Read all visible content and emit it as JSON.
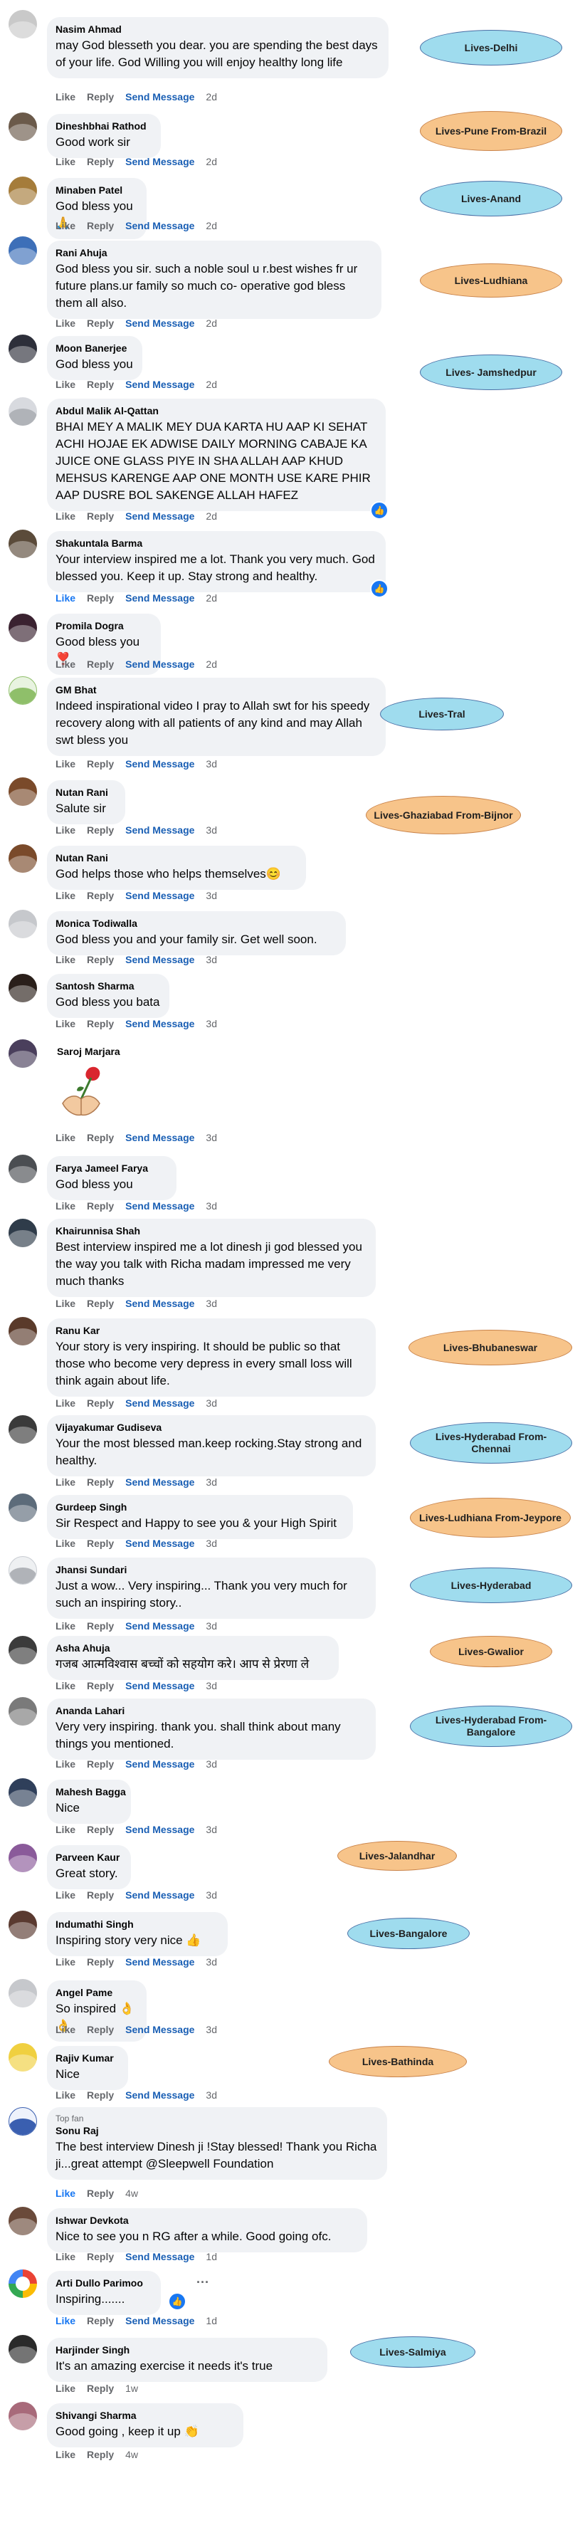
{
  "actions": {
    "like": "Like",
    "reply": "Reply",
    "send": "Send Message"
  },
  "colors": {
    "blue_tag": "#9fdcee",
    "orange_tag": "#f7c48a",
    "bubble": "#f0f2f5",
    "link": "#1a5fb4"
  },
  "comments": [
    {
      "name": "Nasim Ahmad",
      "text": "may God blesseth you dear. you are spending the best days of your life. God Willing you will enjoy healthy long life",
      "time": "2d",
      "location": "Lives-Delhi",
      "tag": "blue"
    },
    {
      "name": "Dineshbhai Rathod",
      "text": "Good work sir",
      "time": "2d",
      "location": "Lives-Pune From-Brazil",
      "tag": "orange"
    },
    {
      "name": "Minaben Patel",
      "text": "God bless you 🙏",
      "time": "2d",
      "location": "Lives-Anand",
      "tag": "blue"
    },
    {
      "name": "Rani Ahuja",
      "text": "God bless you sir. such a noble soul u r.best wishes fr ur future plans.ur family so much co- operative god bless them all also.",
      "time": "2d",
      "location": "Lives-Ludhiana",
      "tag": "orange"
    },
    {
      "name": "Moon Banerjee",
      "text": "God bless you",
      "time": "2d",
      "location": "Lives- Jamshedpur",
      "tag": "blue"
    },
    {
      "name": "Abdul Malik Al-Qattan",
      "text": "BHAI MEY A MALIK MEY DUA KARTA HU AAP KI SEHAT ACHI HOJAE EK ADWISE DAILY MORNING CABAJE KA JUICE ONE GLASS PIYE IN SHA ALLAH AAP KHUD MEHSUS KARENGE AAP ONE MONTH USE KARE PHIR AAP DUSRE BOL SAKENGE ALLAH HAFEZ",
      "time": "2d"
    },
    {
      "name": "Shakuntala Barma",
      "text": "Your interview inspired me a lot. Thank you very much. God blessed you. Keep it up. Stay strong and healthy.",
      "time": "2d"
    },
    {
      "name": "Promila Dogra",
      "text": "Good bless you ❣️",
      "time": "2d"
    },
    {
      "name": "GM Bhat",
      "text": "Indeed inspirational video I pray to Allah swt for his speedy recovery along with all patients of any kind and may Allah swt bless you",
      "time": "3d",
      "location": "Lives-Tral",
      "tag": "blue"
    },
    {
      "name": "Nutan Rani",
      "text": "Salute sir",
      "time": "3d",
      "location": "Lives-Ghaziabad From-Bijnor",
      "tag": "orange"
    },
    {
      "name": "Nutan Rani",
      "text": "God helps those who helps themselves😊",
      "time": "3d"
    },
    {
      "name": "Monica Todiwalla",
      "text": "God bless you and your family sir. Get well soon.",
      "time": "3d"
    },
    {
      "name": "Santosh Sharma",
      "text": "God bless you bata",
      "time": "3d"
    },
    {
      "name": "Saroj Marjara",
      "text": "",
      "time": "3d"
    },
    {
      "name": "Farya Jameel Farya",
      "text": "God bless you",
      "time": "3d"
    },
    {
      "name": "Khairunnisa Shah",
      "text": "Best interview inspired me a lot dinesh ji god blessed you the way you talk with Richa madam impressed me very much thanks",
      "time": "3d"
    },
    {
      "name": "Ranu Kar",
      "text": "Your story is very inspiring. It should be public so that those who become very depress in every small loss will think again about life.",
      "time": "3d",
      "location": "Lives-Bhubaneswar",
      "tag": "orange"
    },
    {
      "name": "Vijayakumar Gudiseva",
      "text": "Your the most blessed man.keep rocking.Stay strong and healthy.",
      "time": "3d",
      "location": "Lives-Hyderabad From-Chennai",
      "tag": "blue"
    },
    {
      "name": "Gurdeep Singh",
      "text": "Sir Respect and Happy to see you & your High Spirit",
      "time": "3d",
      "location": "Lives-Ludhiana From-Jeypore",
      "tag": "orange"
    },
    {
      "name": "Jhansi Sundari",
      "text": "Just a wow... Very inspiring... Thank you very much for such an inspiring story..",
      "time": "3d",
      "location": "Lives-Hyderabad",
      "tag": "blue"
    },
    {
      "name": "Asha Ahuja",
      "text": "गजब आत्मविश्वास बच्चों को सहयोग करे। आप से प्रेरणा ले",
      "time": "3d",
      "location": "Lives-Gwalior",
      "tag": "orange"
    },
    {
      "name": "Ananda Lahari",
      "text": "Very very inspiring. thank you. shall think about many things you mentioned.",
      "time": "3d",
      "location": "Lives-Hyderabad From-Bangalore",
      "tag": "blue"
    },
    {
      "name": "Mahesh Bagga",
      "text": "Nice",
      "time": "3d"
    },
    {
      "name": "Parveen Kaur",
      "text": "Great story.",
      "time": "3d",
      "location": "Lives-Jalandhar",
      "tag": "orange"
    },
    {
      "name": "Indumathi Singh",
      "text": "Inspiring story very nice 👍",
      "time": "3d",
      "location": "Lives-Bangalore",
      "tag": "blue"
    },
    {
      "name": "Angel Pame",
      "text": "So inspired 👌👌",
      "time": "3d"
    },
    {
      "name": "Rajiv Kumar",
      "text": "Nice",
      "time": "3d",
      "location": "Lives-Bathinda",
      "tag": "orange"
    },
    {
      "name": "Sonu Raj",
      "badge": "Top fan",
      "text": "The best interview Dinesh ji !Stay blessed! Thank you Richa ji...great attempt @Sleepwell Foundation",
      "time": "4w"
    },
    {
      "name": "Ishwar Devkota",
      "text": "Nice to see you n RG after a while. Good going ofc.",
      "time": "1d"
    },
    {
      "name": "Arti Dullo Parimoo",
      "text": "Inspiring.......",
      "time": "1d"
    },
    {
      "name": "Harjinder Singh",
      "text": "It's an amazing exercise it needs it's true",
      "time": "1w",
      "location": "Lives-Salmiya",
      "tag": "blue"
    },
    {
      "name": "Shivangi Sharma",
      "text": "Good going , keep it up 👏",
      "time": "4w"
    }
  ]
}
